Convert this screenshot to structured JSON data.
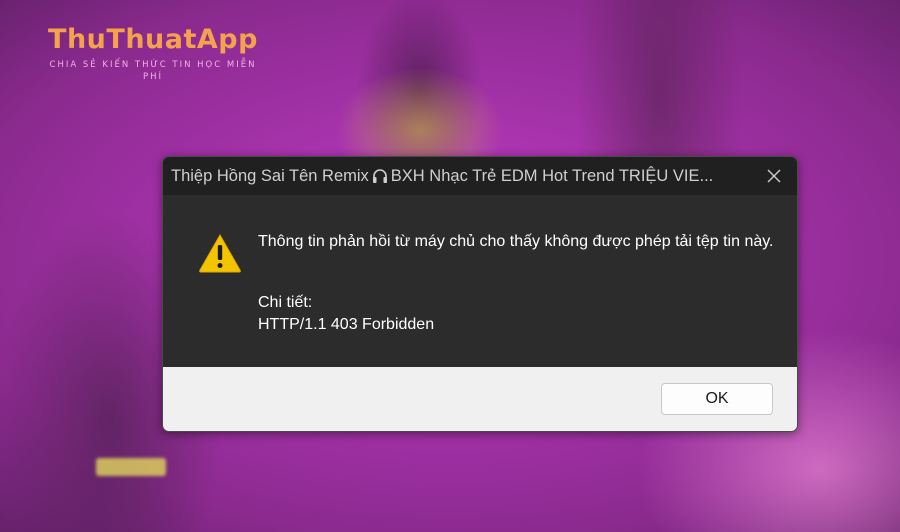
{
  "watermark": {
    "logo": "ThuThuatApp",
    "tagline": "CHIA SẺ KIẾN THỨC TIN HỌC MIỄN PHÍ"
  },
  "dialog": {
    "title_part1": "Thiệp Hồng Sai Tên Remix",
    "title_icon": "headphones-icon",
    "title_part2": "BXH Nhạc Trẻ EDM Hot Trend TRIỆU VIE...",
    "icon": "warning-icon",
    "message": "Thông tin phản hồi từ máy chủ cho thấy không được phép tải tệp tin này.",
    "detail_label": "Chi tiết:",
    "detail_value": "HTTP/1.1 403 Forbidden",
    "ok_label": "OK",
    "close_icon": "close-icon"
  },
  "colors": {
    "title_bar": "#202020",
    "content_bg": "#2c2c2c",
    "footer_bg": "#f0f0f0",
    "warning": "#f5c400",
    "watermark_logo": "#f4a24b"
  }
}
